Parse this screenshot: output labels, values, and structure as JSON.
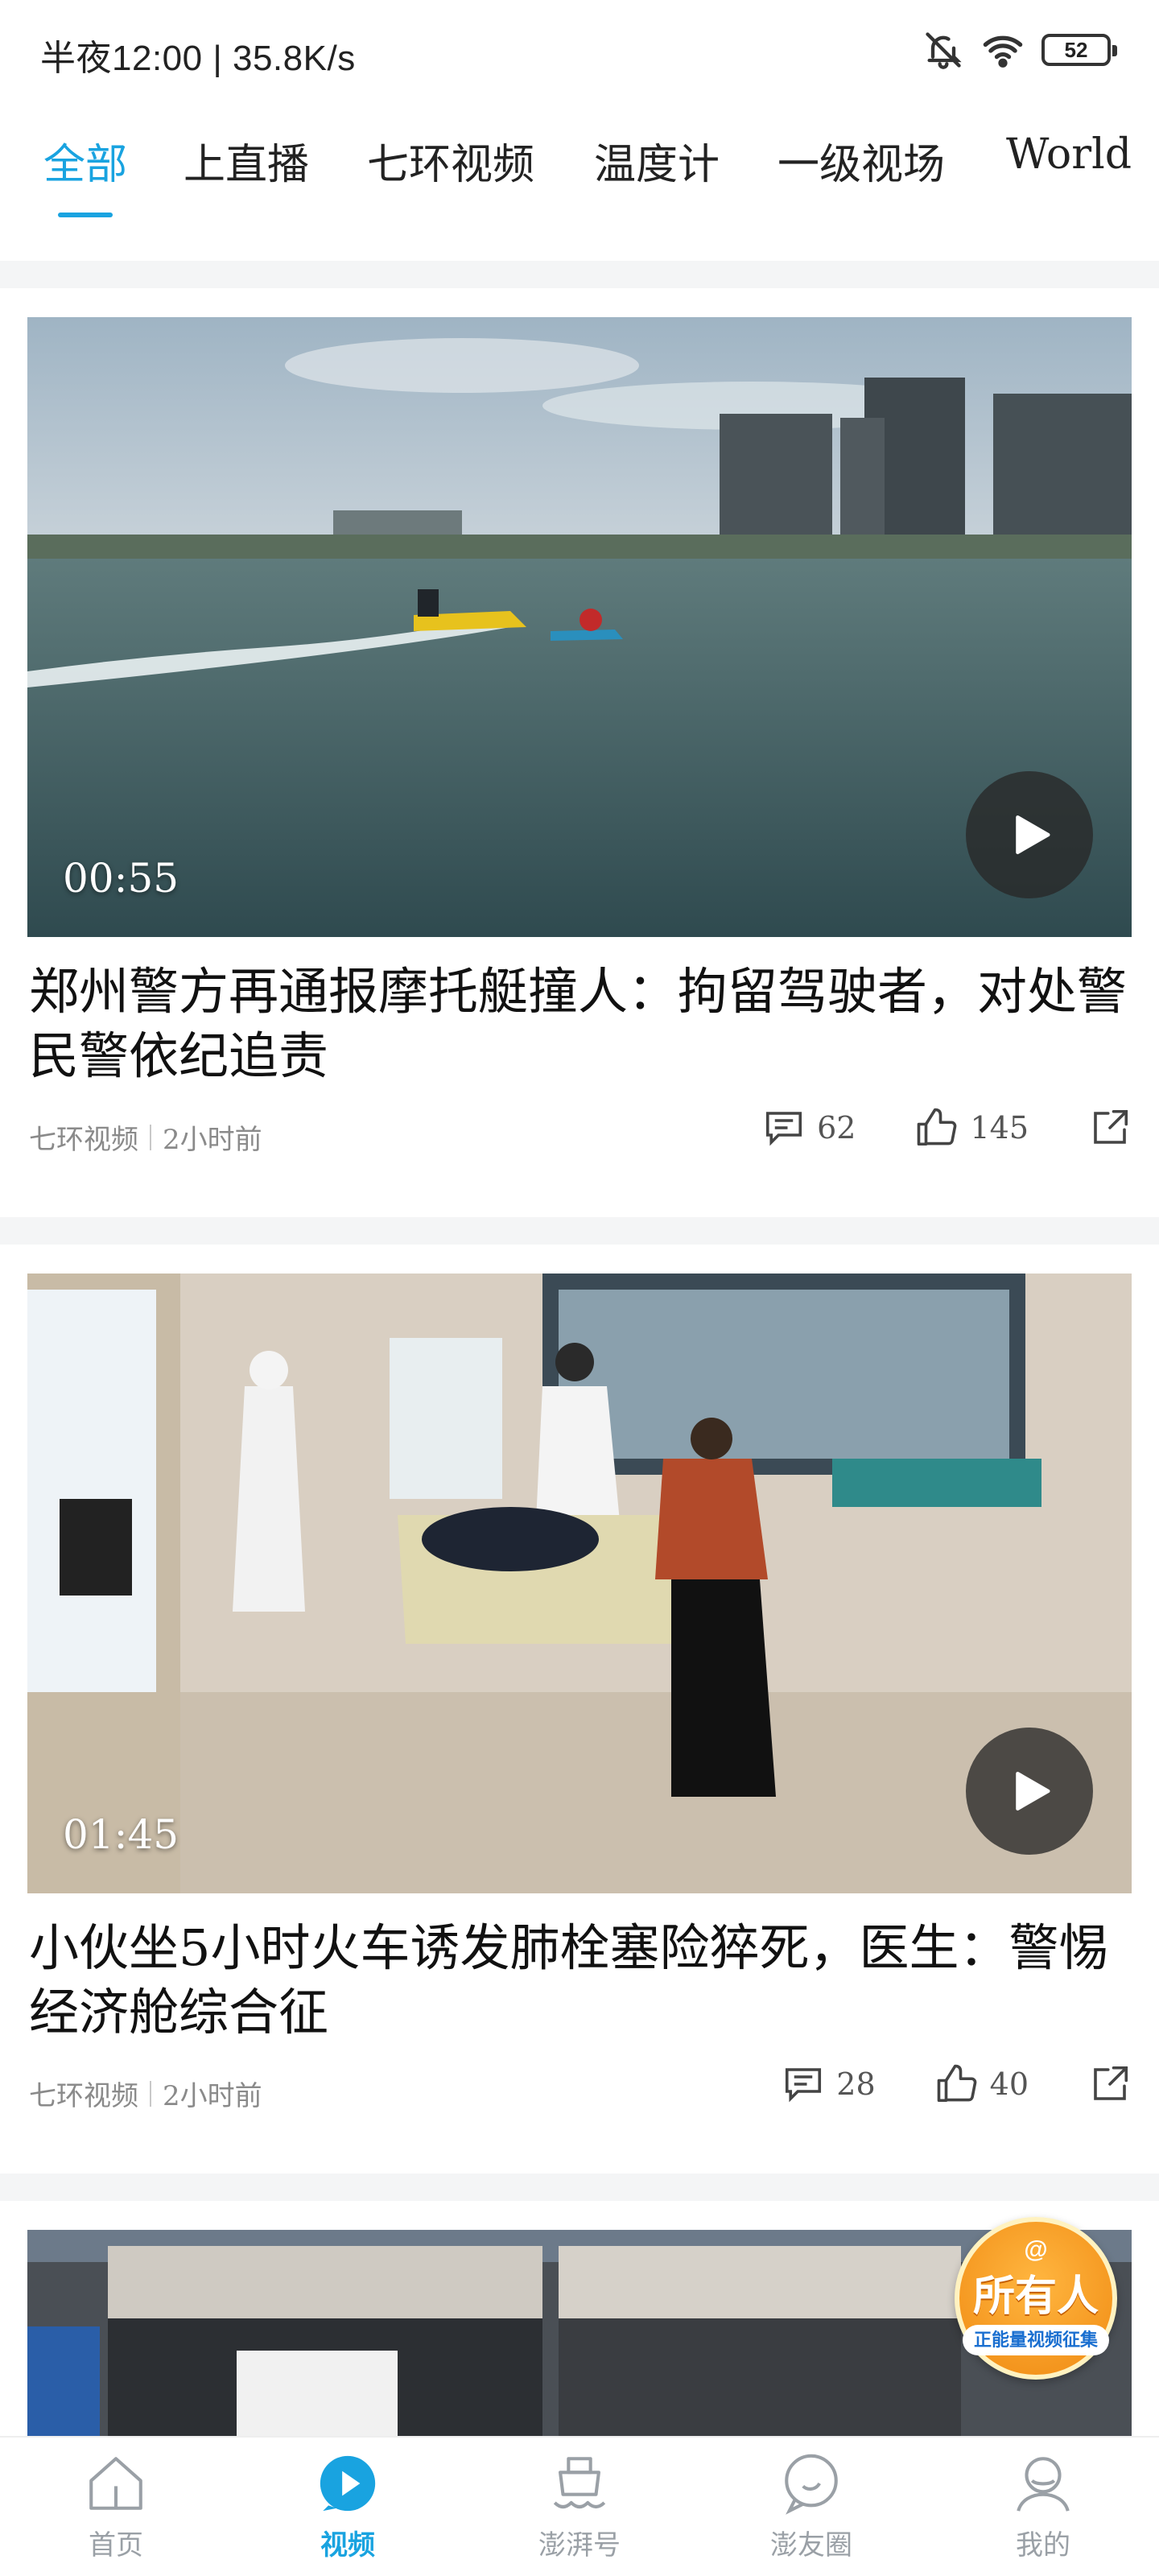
{
  "status_bar": {
    "time_speed": "半夜12:00 | 35.8K/s",
    "battery": "52",
    "icons": [
      "bell-off-icon",
      "wifi-icon",
      "battery-icon"
    ]
  },
  "tabs": [
    {
      "label": "全部",
      "active": true
    },
    {
      "label": "上直播"
    },
    {
      "label": "七环视频"
    },
    {
      "label": "温度计"
    },
    {
      "label": "一级视场"
    },
    {
      "label": "World"
    }
  ],
  "videos": [
    {
      "duration": "00:55",
      "title": "郑州警方再通报摩托艇撞人：拘留驾驶者，对处警民警依纪追责",
      "source": "七环视频",
      "time": "2小时前",
      "comments": "62",
      "likes": "145"
    },
    {
      "duration": "01:45",
      "title": "小伙坐5小时火车诱发肺栓塞险猝死，医生：警惕经济舱综合征",
      "source": "七环视频",
      "time": "2小时前",
      "comments": "28",
      "likes": "40"
    }
  ],
  "badge": {
    "at": "@",
    "main": "所有人",
    "sub": "正能量视频征集"
  },
  "bottom_nav": [
    {
      "label": "首页",
      "icon": "home-icon"
    },
    {
      "label": "视频",
      "icon": "video-play-icon",
      "active": true
    },
    {
      "label": "澎湃号",
      "icon": "ship-icon"
    },
    {
      "label": "澎友圈",
      "icon": "chat-bubble-icon"
    },
    {
      "label": "我的",
      "icon": "user-icon"
    }
  ],
  "colors": {
    "accent": "#19a3e0",
    "separator": "#f4f5f6",
    "meta_text": "#8a8a8a"
  }
}
